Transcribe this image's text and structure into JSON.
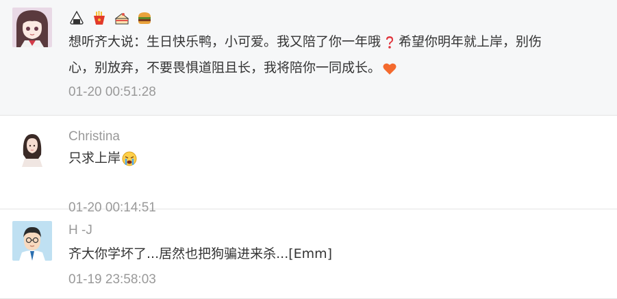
{
  "comments": [
    {
      "author": "想听齐大说",
      "author_suffix": "：",
      "text_part1": "生日快乐鸭，小可爱。我又陪了你一年哦",
      "text_part2": "希望你明年就上岸，别伤",
      "text_line2": "心，别放弃，不要畏惧道阻且长，我将陪你一同成长。",
      "time": "01-20 00:51:28",
      "badges": [
        "rice-ball-icon",
        "fries-icon",
        "cake-icon",
        "burger-icon"
      ],
      "inline_emojis": [
        "red-question-mark-icon",
        "orange-heart-icon"
      ]
    },
    {
      "author": "Christina",
      "text": "只求上岸",
      "time": "01-20 00:14:51",
      "inline_emojis": [
        "crying-face-icon"
      ]
    },
    {
      "author": "H -J",
      "text": "齐大你学坏了...居然也把狗骗进来杀...[Emm]",
      "time": "01-19 23:58:03"
    }
  ],
  "colors": {
    "highlight_bg": "#f6f7f8",
    "meta_text": "#999999",
    "body_text": "#333333",
    "divider": "#e3e3e3",
    "heart": "#f46a2e",
    "question_mark": "#e0323a"
  }
}
